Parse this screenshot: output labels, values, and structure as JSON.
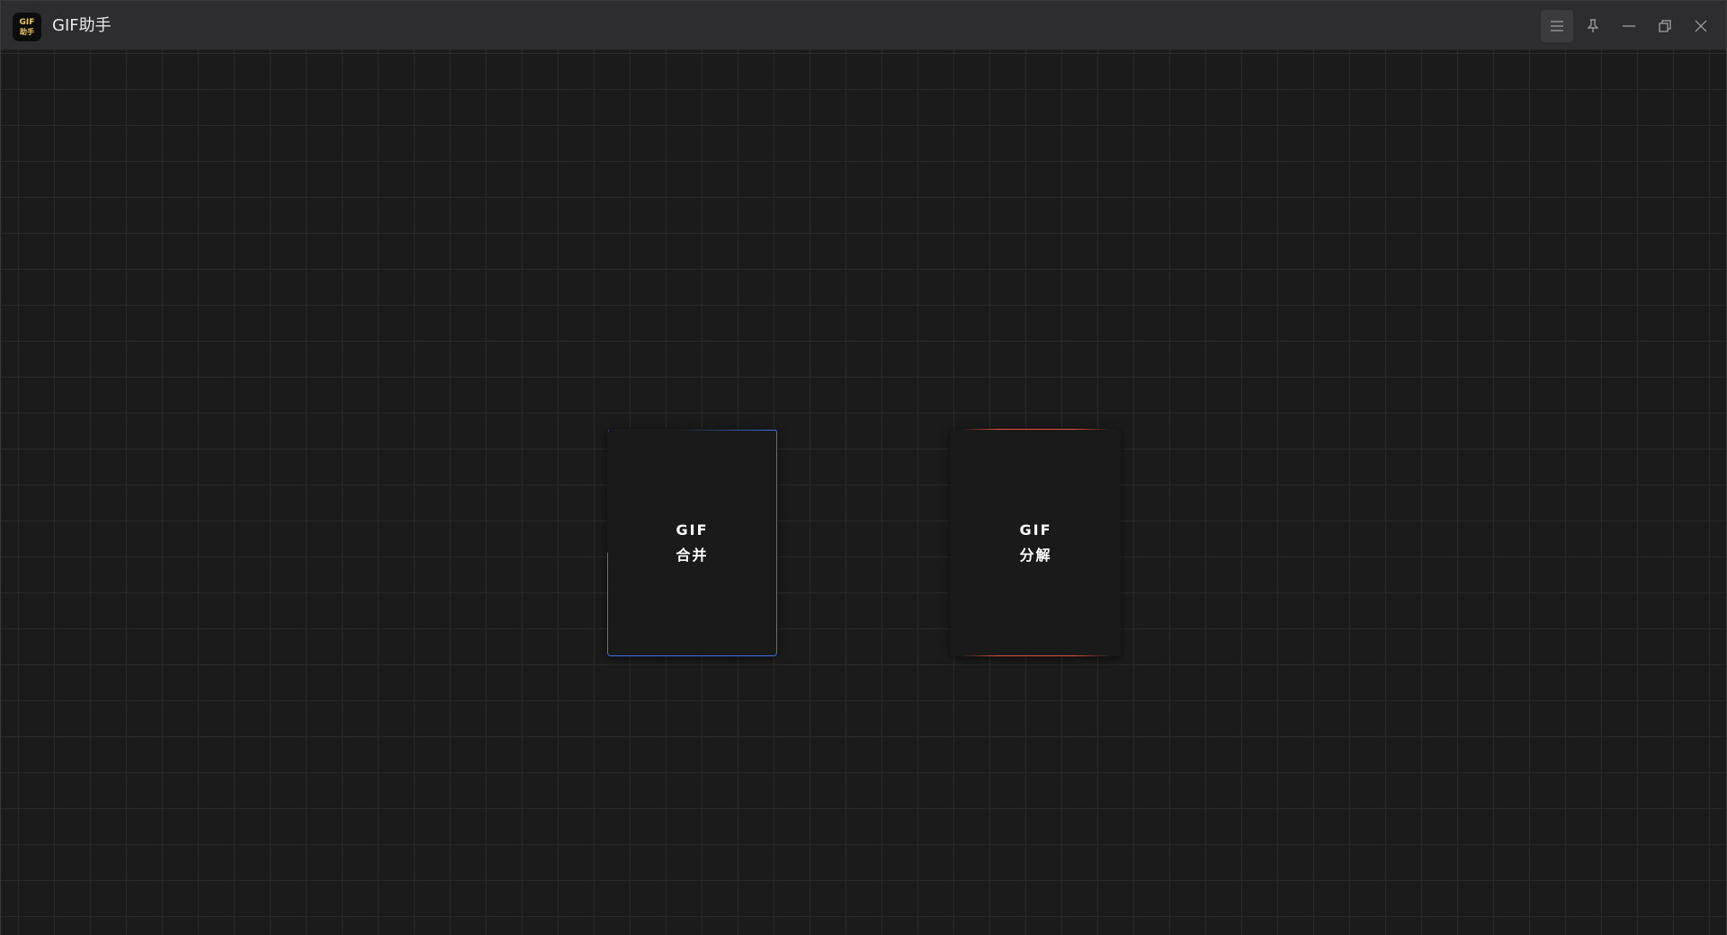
{
  "app": {
    "title": "GIF助手",
    "logo_line1": "GIF",
    "logo_line2": "助手"
  },
  "titlebar": {
    "buttons": [
      {
        "name": "menu",
        "icon": "menu-icon"
      },
      {
        "name": "pin",
        "icon": "pin-icon"
      },
      {
        "name": "minimize",
        "icon": "minimize-icon"
      },
      {
        "name": "maximize",
        "icon": "restore-icon"
      },
      {
        "name": "close",
        "icon": "close-icon"
      }
    ]
  },
  "cards": {
    "merge": {
      "line1": "GIF",
      "line2": "合并",
      "accent": "#3b6fe6"
    },
    "split": {
      "line1": "GIF",
      "line2": "分解",
      "accent": "#e0533a"
    }
  },
  "colors": {
    "background": "#1b1b1b",
    "grid": "#2a2a2a",
    "titlebar": "#2d2d2f",
    "logo_text": "#f2c94c"
  }
}
